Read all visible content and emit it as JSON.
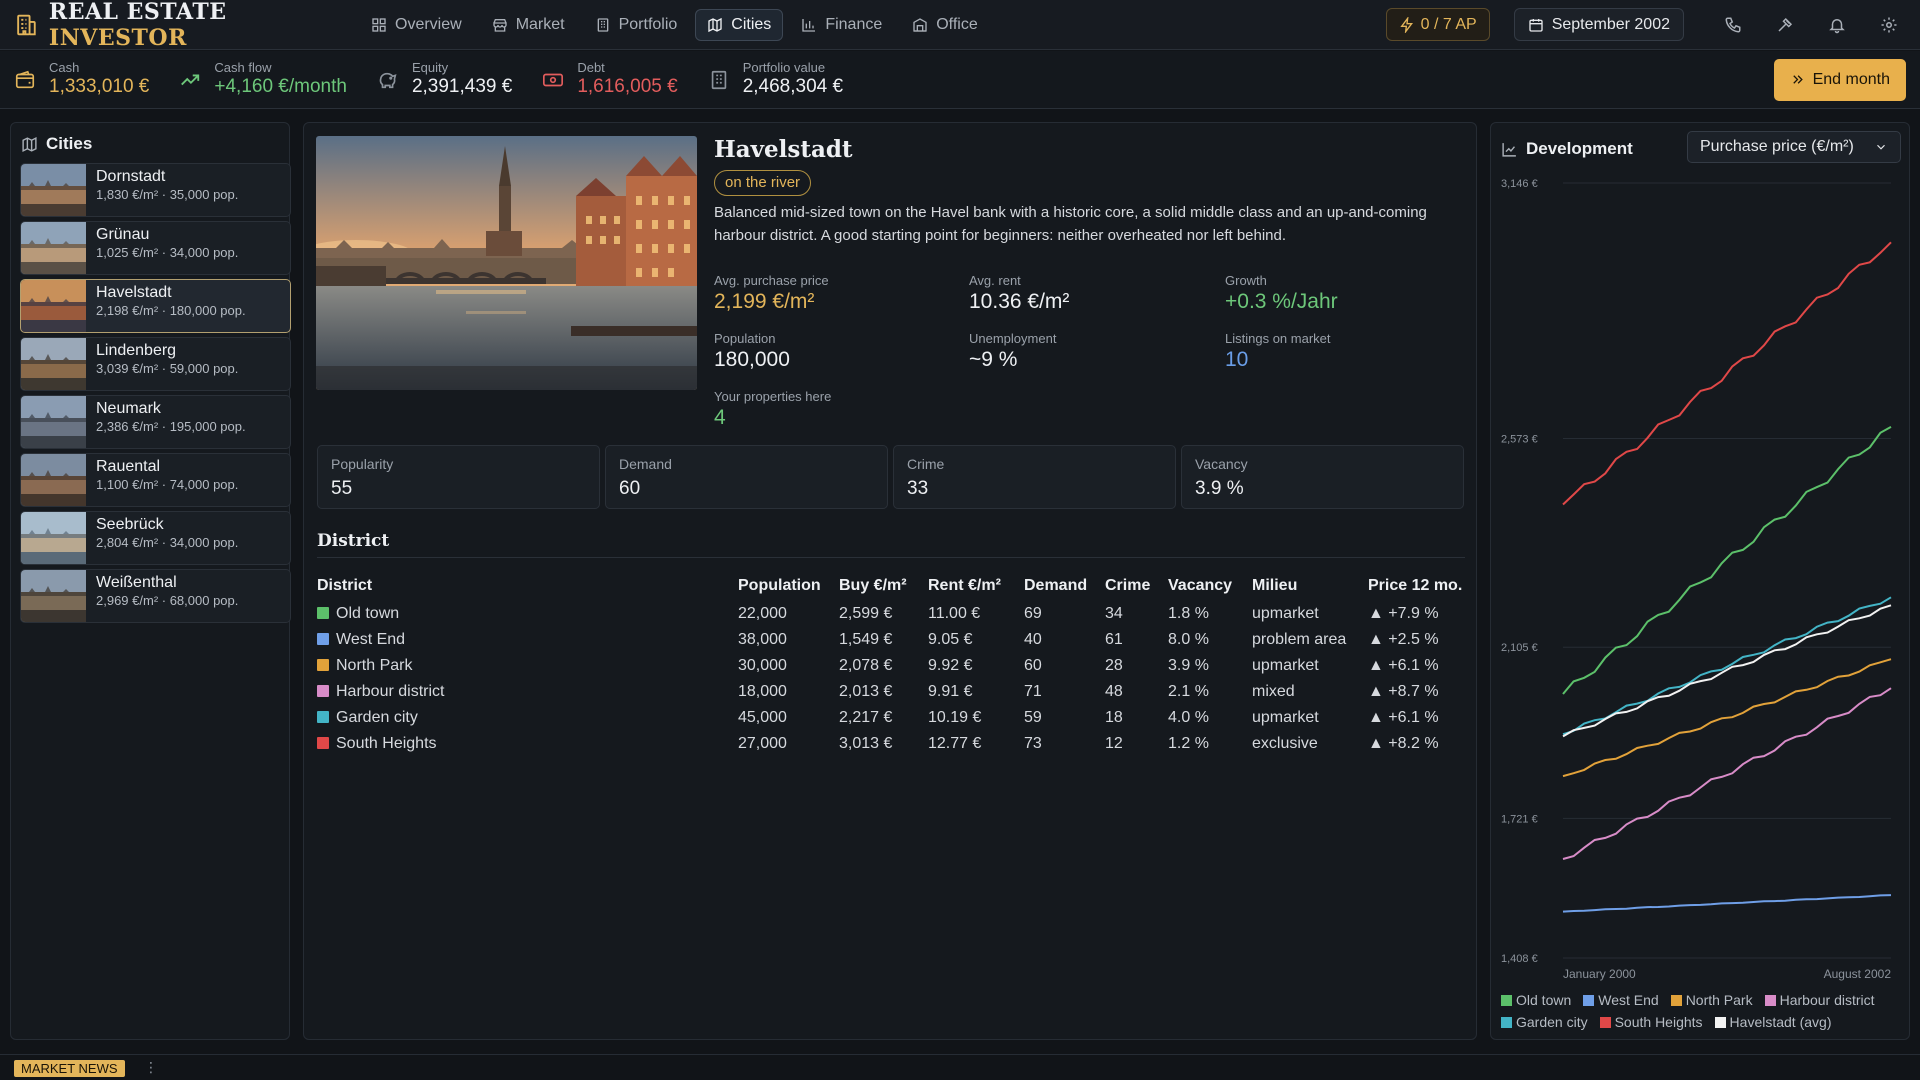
{
  "app": {
    "title_part1": "REAL ESTATE",
    "title_part2": "INVESTOR"
  },
  "nav": {
    "tabs": [
      {
        "label": "Overview",
        "icon": "grid-icon"
      },
      {
        "label": "Market",
        "icon": "store-icon"
      },
      {
        "label": "Portfolio",
        "icon": "building-icon"
      },
      {
        "label": "Cities",
        "icon": "map-icon",
        "active": true
      },
      {
        "label": "Finance",
        "icon": "bar-chart-icon"
      },
      {
        "label": "Office",
        "icon": "office-icon"
      }
    ],
    "ap": "0 / 7 AP",
    "date": "September 2002"
  },
  "stats": {
    "cash": {
      "label": "Cash",
      "value": "1,333,010 €"
    },
    "cashflow": {
      "label": "Cash flow",
      "value": "+4,160 €/month"
    },
    "equity": {
      "label": "Equity",
      "value": "2,391,439 €"
    },
    "debt": {
      "label": "Debt",
      "value": "1,616,005 €"
    },
    "portfolio": {
      "label": "Portfolio value",
      "value": "2,468,304 €"
    },
    "end_month": "End month"
  },
  "cities_panel": {
    "title": "Cities",
    "items": [
      {
        "name": "Dornstadt",
        "meta": "1,830 €/m²  ·  35,000 pop."
      },
      {
        "name": "Grünau",
        "meta": "1,025 €/m²  ·  34,000 pop."
      },
      {
        "name": "Havelstadt",
        "meta": "2,198 €/m²  ·  180,000 pop.",
        "active": true
      },
      {
        "name": "Lindenberg",
        "meta": "3,039 €/m²  ·  59,000 pop."
      },
      {
        "name": "Neumark",
        "meta": "2,386 €/m²  ·  195,000 pop."
      },
      {
        "name": "Rauental",
        "meta": "1,100 €/m²  ·  74,000 pop."
      },
      {
        "name": "Seebrück",
        "meta": "2,804 €/m²  ·  34,000 pop."
      },
      {
        "name": "Weißenthal",
        "meta": "2,969 €/m²  ·  68,000 pop."
      }
    ]
  },
  "city": {
    "name": "Havelstadt",
    "tag": "on the river",
    "description": "Balanced mid-sized town on the Havel bank with a historic core, a solid middle class and an up-and-coming harbour district. A good starting point for beginners: neither overheated nor left behind.",
    "avg_price": {
      "label": "Avg. purchase price",
      "value": "2,199 €/m²"
    },
    "avg_rent": {
      "label": "Avg. rent",
      "value": "10.36 €/m²"
    },
    "growth": {
      "label": "Growth",
      "value": "+0.3 %/Jahr"
    },
    "population": {
      "label": "Population",
      "value": "180,000"
    },
    "unemployment": {
      "label": "Unemployment",
      "value": "~9 %"
    },
    "listings": {
      "label": "Listings on market",
      "value": "10"
    },
    "your_props": {
      "label": "Your properties here",
      "value": "4"
    },
    "cards": [
      {
        "label": "Popularity",
        "value": "55"
      },
      {
        "label": "Demand",
        "value": "60"
      },
      {
        "label": "Crime",
        "value": "33"
      },
      {
        "label": "Vacancy",
        "value": "3.9 %"
      }
    ]
  },
  "district": {
    "title": "District",
    "columns": [
      "District",
      "Population",
      "Buy €/m²",
      "Rent €/m²",
      "Demand",
      "Crime",
      "Vacancy",
      "Milieu",
      "Price 12 mo."
    ],
    "rows": [
      {
        "name": "Old town",
        "color": "#5cc06a",
        "population": "22,000",
        "buy": "2,599 €",
        "rent": "11.00 €",
        "demand": "69",
        "crime": "34",
        "vacancy": "1.8 %",
        "milieu": "upmarket",
        "change": "+7.9 %"
      },
      {
        "name": "West End",
        "color": "#6f9fe8",
        "population": "38,000",
        "buy": "1,549 €",
        "rent": "9.05 €",
        "demand": "40",
        "crime": "61",
        "vacancy": "8.0 %",
        "milieu": "problem area",
        "change": "+2.5 %"
      },
      {
        "name": "North Park",
        "color": "#e2a23a",
        "population": "30,000",
        "buy": "2,078 €",
        "rent": "9.92 €",
        "demand": "60",
        "crime": "28",
        "vacancy": "3.9 %",
        "milieu": "upmarket",
        "change": "+6.1 %"
      },
      {
        "name": "Harbour district",
        "color": "#d88cc8",
        "population": "18,000",
        "buy": "2,013 €",
        "rent": "9.91 €",
        "demand": "71",
        "crime": "48",
        "vacancy": "2.1 %",
        "milieu": "mixed",
        "change": "+8.7 %"
      },
      {
        "name": "Garden city",
        "color": "#43b4c6",
        "population": "45,000",
        "buy": "2,217 €",
        "rent": "10.19 €",
        "demand": "59",
        "crime": "18",
        "vacancy": "4.0 %",
        "milieu": "upmarket",
        "change": "+6.1 %"
      },
      {
        "name": "South Heights",
        "color": "#e04848",
        "population": "27,000",
        "buy": "3,013 €",
        "rent": "12.77 €",
        "demand": "73",
        "crime": "12",
        "vacancy": "1.2 %",
        "milieu": "exclusive",
        "change": "+8.2 %"
      }
    ]
  },
  "development": {
    "title": "Development",
    "metric": "Purchase price (€/m²)"
  },
  "chart_data": {
    "type": "line",
    "ylim": [
      1408,
      3146
    ],
    "yticks": [
      "3,146 €",
      "2,573 €",
      "2,105 €",
      "1,721 €",
      "1,408 €"
    ],
    "ytick_values": [
      3146,
      2573,
      2105,
      1721,
      1408
    ],
    "x_start_label": "January 2000",
    "x_end_label": "August 2002",
    "points_per_series": 32,
    "series": [
      {
        "name": "Old town",
        "color": "#5cc06a",
        "start": 2000,
        "end": 2599
      },
      {
        "name": "West End",
        "color": "#6f9fe8",
        "start": 1512,
        "end": 1549
      },
      {
        "name": "North Park",
        "color": "#e2a23a",
        "start": 1816,
        "end": 2078
      },
      {
        "name": "Harbour district",
        "color": "#d88cc8",
        "start": 1630,
        "end": 2013
      },
      {
        "name": "Garden city",
        "color": "#43b4c6",
        "start": 1910,
        "end": 2217
      },
      {
        "name": "South Heights",
        "color": "#e04848",
        "start": 2425,
        "end": 3013
      },
      {
        "name": "Havelstadt (avg)",
        "color": "#f2f2f2",
        "start": 1905,
        "end": 2199
      }
    ]
  },
  "footer": {
    "news": "MARKET NEWS",
    "more": "⋮"
  }
}
